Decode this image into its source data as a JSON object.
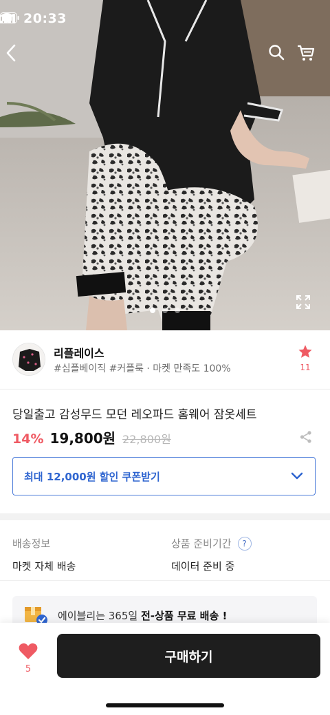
{
  "status_bar": {
    "time": "20:33"
  },
  "topbar": {
    "back_icon": "chevron-left-icon",
    "search_icon": "search-icon",
    "cart_icon": "cart-icon"
  },
  "gallery": {
    "image_count": 3,
    "active_index": 0,
    "expand_icon": "expand-icon"
  },
  "store": {
    "name": "리플레이스",
    "tags": "#심플베이직 #커플룩 · 마켓 만족도 100%",
    "favorite_count": "11",
    "favorite_icon": "star-icon"
  },
  "product": {
    "title": "당일출고 감성무드 모던 레오파드 홈웨어 잠옷세트",
    "discount": "14%",
    "price": "19,800원",
    "original_price": "22,800원",
    "share_icon": "share-icon"
  },
  "coupon": {
    "label": "최대 12,000원 할인 쿠폰받기",
    "chevron_icon": "chevron-down-icon"
  },
  "shipping": {
    "info_label": "배송정보",
    "info_value": "마켓 자체 배송",
    "prep_label": "상품 준비기간",
    "prep_help": "?",
    "prep_value": "데이터 준비 중"
  },
  "banner": {
    "prefix": "에이블리는 365일 ",
    "highlight": "전-상품 무료 배송 !",
    "icon": "delivery-box-icon"
  },
  "bottom_bar": {
    "like_count": "5",
    "like_icon": "heart-icon",
    "buy_label": "구매하기"
  },
  "colors": {
    "accent_red": "#ef5a63",
    "accent_blue": "#2f65d0",
    "buy_button": "#1e1e1e"
  }
}
